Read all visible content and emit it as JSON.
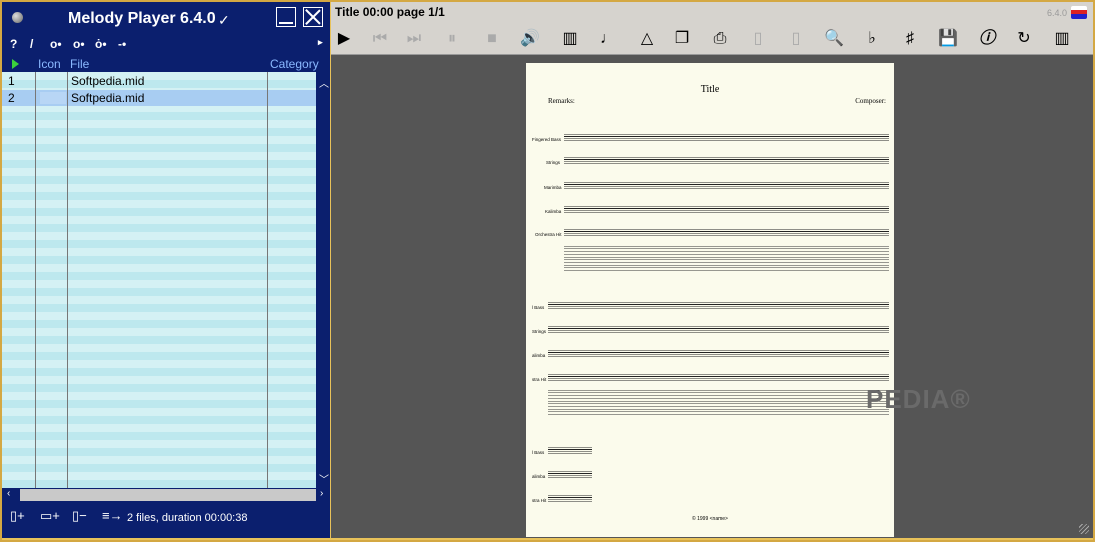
{
  "app": {
    "title": "Melody Player 6.4.0"
  },
  "columns": {
    "icon": "Icon",
    "file": "File",
    "category": "Category"
  },
  "files": [
    {
      "num": "1",
      "file": "Softpedia.mid",
      "selected": false
    },
    {
      "num": "2",
      "file": "Softpedia.mid",
      "selected": true
    }
  ],
  "status": "2 files, duration 00:00:38",
  "viewer": {
    "title": "Title 00:00 page 1/1",
    "version": "6.4.0"
  },
  "score": {
    "title": "Title",
    "remarks": "Remarks:",
    "composer": "Composer:",
    "copyright": "© 1999 <name>",
    "system1_instruments": [
      "Fingered Bass",
      "Strings",
      "Marimba",
      "Kalimba",
      "Orchestra Hit"
    ],
    "system2_instruments": [
      "l Bass",
      "Strings",
      "alimba",
      "stra Hit"
    ],
    "system3_instruments": [
      "l Bass",
      "alimba",
      "stra Hit"
    ]
  },
  "watermark": "PEDIA®"
}
